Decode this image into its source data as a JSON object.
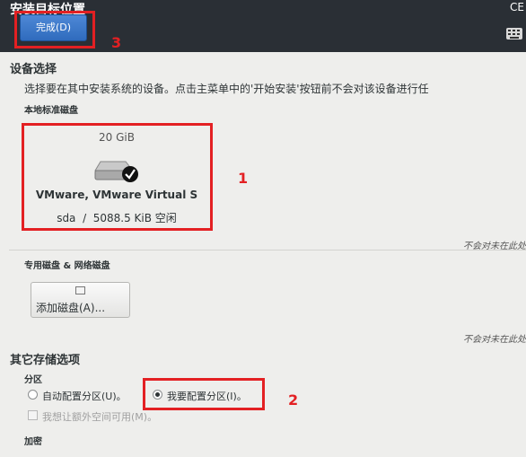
{
  "header": {
    "title": "安装目标位置",
    "product": "CE",
    "done_button": "完成(D)",
    "keyboard_icon": "keyboard-icon"
  },
  "device_selection": {
    "heading": "设备选择",
    "description": "选择要在其中安装系统的设备。点击主菜单中的'开始安装'按钮前不会对该设备进行任",
    "local_disks_label": "本地标准磁盘",
    "disk": {
      "size": "20 GiB",
      "name": "VMware, VMware Virtual S",
      "device": "sda",
      "separator": "/",
      "free": "5088.5 KiB 空闲",
      "icon": "hard-disk-icon",
      "selected": true
    },
    "note_1": "不会对未在此处",
    "specialized_label": "专用磁盘 & 网络磁盘",
    "add_disk_button": "添加磁盘(A)...",
    "note_2": "不会对未在此处"
  },
  "other_storage": {
    "heading": "其它存储选项",
    "partition_label": "分区",
    "auto_partition": "自动配置分区(U)。",
    "manual_partition": "我要配置分区(I)。",
    "extra_space": "我想让额外空间可用(M)。",
    "encryption_label": "加密",
    "selected_option": "manual"
  },
  "annotations": {
    "marker_1": "1",
    "marker_2": "2",
    "marker_3": "3",
    "color": "#e32023"
  }
}
